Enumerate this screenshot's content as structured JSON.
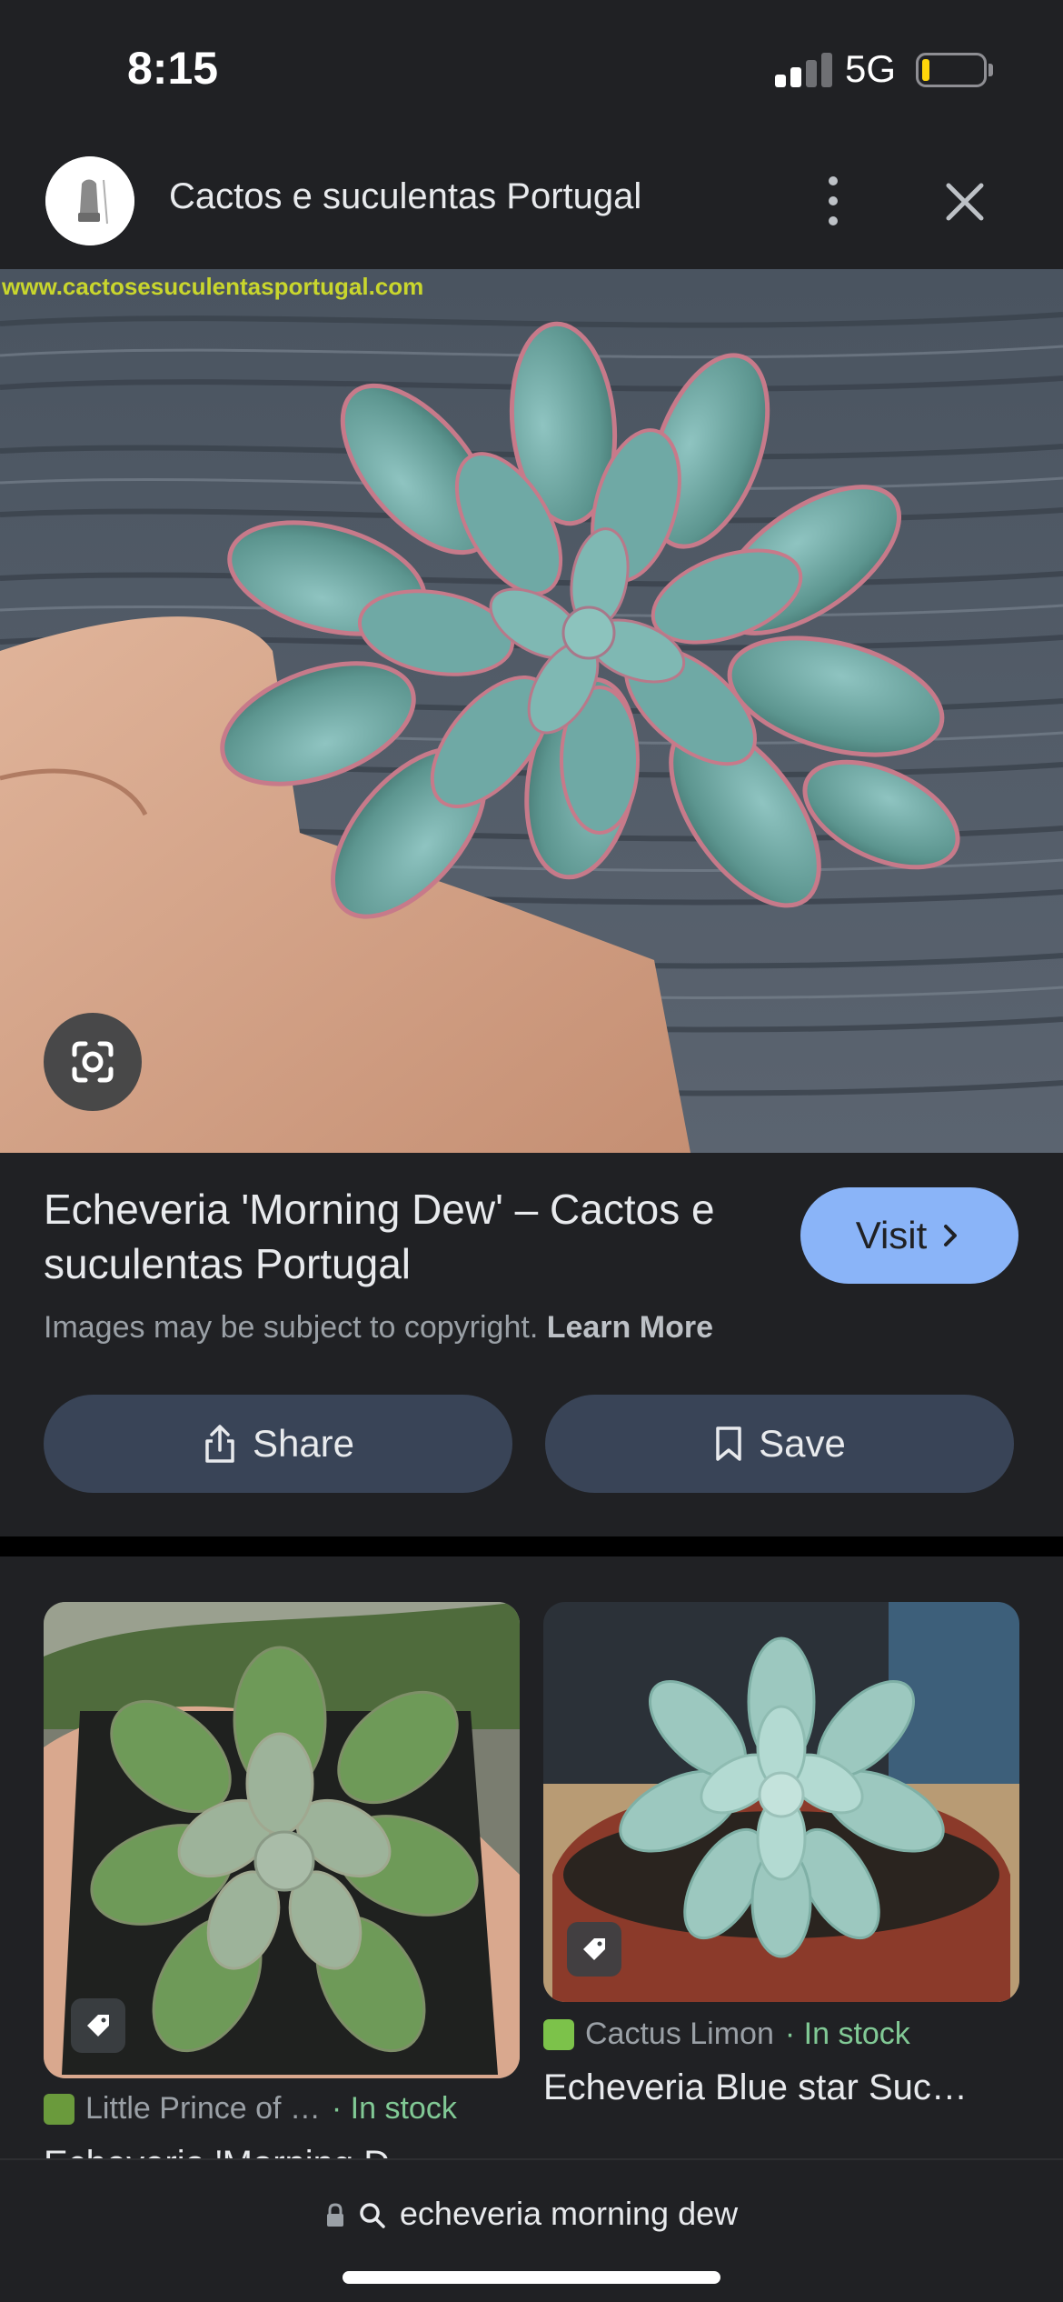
{
  "status_bar": {
    "time": "8:15",
    "network": "5G"
  },
  "header": {
    "title": "Cactos e suculentas Portugal"
  },
  "main_image": {
    "watermark": "www.cactosesuculentasportugal.com"
  },
  "info": {
    "title": "Echeveria 'Morning Dew' – Cactos e suculentas Portugal",
    "visit_label": "Visit",
    "copyright_text": "Images may be subject to copyright.",
    "learn_more": "Learn More",
    "share_label": "Share",
    "save_label": "Save"
  },
  "results": [
    {
      "source": "Little Prince of …",
      "stock": "· In stock",
      "title": "Echeveria 'Morning D…"
    },
    {
      "source": "Cactus Limon",
      "stock": "· In stock",
      "title": "Echeveria Blue star Suc…"
    }
  ],
  "bottom_bar": {
    "query": "echeveria morning dew"
  },
  "colors": {
    "accent": "#8ab4f8",
    "in_stock": "#81c995",
    "background": "#202124",
    "button": "#394457"
  },
  "icons": [
    "signal-icon",
    "battery-icon",
    "more-vert-icon",
    "close-icon",
    "lens-icon",
    "chevron-right-icon",
    "share-icon",
    "bookmark-icon",
    "tag-icon",
    "lock-icon",
    "search-icon"
  ]
}
